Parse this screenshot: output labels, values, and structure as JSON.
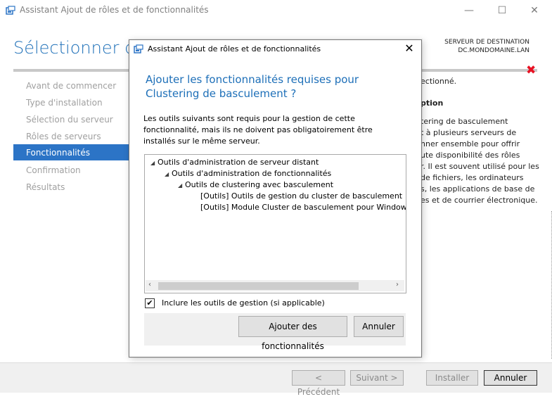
{
  "window": {
    "title": "Assistant Ajout de rôles et de fonctionnalités",
    "controls": {
      "minimize": "—",
      "maximize": "☐",
      "close": "✕"
    },
    "heading": "Sélectionner des",
    "destination_label": "SERVEUR DE DESTINATION",
    "destination_value": "DC.MONDOMAINE.LAN",
    "error_mark": "✖"
  },
  "nav": {
    "items": [
      {
        "label": "Avant de commencer"
      },
      {
        "label": "Type d'installation"
      },
      {
        "label": "Sélection du serveur"
      },
      {
        "label": "Rôles de serveurs"
      },
      {
        "label": "Fonctionnalités"
      },
      {
        "label": "Confirmation"
      },
      {
        "label": "Résultats"
      }
    ],
    "active_index": 4
  },
  "right_panel": {
    "line1": "ectionné.",
    "section_title": "ption",
    "lines": [
      "tering de basculement",
      "t à plusieurs serveurs de",
      "nner ensemble pour offrir",
      "ute disponibilité des rôles",
      "r. Il est souvent utilisé pour les",
      "de fichiers, les ordinateurs",
      "s, les applications de base de",
      "es et de courrier électronique."
    ]
  },
  "footer": {
    "previous": "< Précédent",
    "next": "Suivant >",
    "install": "Installer",
    "cancel": "Annuler"
  },
  "dialog": {
    "title": "Assistant Ajout de rôles et de fonctionnalités",
    "close": "✕",
    "heading": "Ajouter les fonctionnalités requises pour Clustering de basculement ?",
    "description": "Les outils suivants sont requis pour la gestion de cette fonctionnalité, mais ils ne doivent pas obligatoirement être installés sur le même serveur.",
    "tree": [
      {
        "label": "Outils d'administration de serveur distant",
        "expanded": true
      },
      {
        "label": "Outils d'administration de fonctionnalités",
        "expanded": true
      },
      {
        "label": "Outils de clustering avec basculement",
        "expanded": true
      },
      {
        "label": "[Outils] Outils de gestion du cluster de basculement"
      },
      {
        "label": "[Outils] Module Cluster de basculement pour Windows"
      }
    ],
    "checkbox_label": "Inclure les outils de gestion (si applicable)",
    "checkbox_checked": true,
    "add_button": "Ajouter des fonctionnalités",
    "cancel_button": "Annuler"
  },
  "colors": {
    "accent": "#1d6fb8",
    "nav_active": "#2c74c6",
    "error": "#e81123"
  }
}
